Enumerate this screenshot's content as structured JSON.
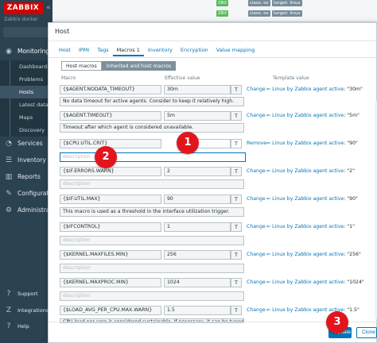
{
  "sidebar": {
    "logo": "ZABBIX",
    "subtitle": "Zabbix docker",
    "collapse_icon": "«",
    "items": [
      {
        "label": "Monitoring",
        "icon": "eye-icon",
        "glyph": "◉"
      },
      {
        "label": "Services",
        "icon": "services-icon",
        "glyph": "◔"
      },
      {
        "label": "Inventory",
        "icon": "inventory-icon",
        "glyph": "☰"
      },
      {
        "label": "Reports",
        "icon": "reports-icon",
        "glyph": "▥"
      },
      {
        "label": "Configurat",
        "icon": "config-icon",
        "glyph": "✎"
      },
      {
        "label": "Administra",
        "icon": "admin-icon",
        "glyph": "⚙"
      },
      {
        "label": "Support",
        "icon": "support-icon",
        "glyph": "?"
      },
      {
        "label": "Integrations",
        "icon": "integrations-icon",
        "glyph": "Z"
      },
      {
        "label": "Help",
        "icon": "help-icon",
        "glyph": "?"
      }
    ],
    "submenu": [
      "Dashboard",
      "Problems",
      "Hosts",
      "Latest data",
      "Maps",
      "Discovery"
    ]
  },
  "topstrip": {
    "tag_zbx_1": "ZBX",
    "tag_zbx_2": "ZBX",
    "tag_class_os": "class: os",
    "tag_target_linux": "target: linux"
  },
  "dialog": {
    "title": "Host",
    "tabs": [
      "Host",
      "IPMI",
      "Tags",
      "Macros 1",
      "Inventory",
      "Encryption",
      "Value mapping"
    ],
    "subtabs": [
      "Host macros",
      "Inherited and host macros"
    ],
    "col_macro": "Macro",
    "col_effective": "Effective value",
    "col_template": "Template value",
    "type_glyph": "T",
    "description_placeholder": "description",
    "rows": [
      {
        "macro": "{$AGENT.NODATA_TIMEOUT}",
        "value": "30m",
        "action": "Change",
        "template": "Linux by Zabbix agent active",
        "tvalue": "\"30m\"",
        "desc": "No data timeout for active agents. Consider to keep it relatively high."
      },
      {
        "macro": "{$AGENT.TIMEOUT}",
        "value": "5m",
        "action": "Change",
        "template": "Linux by Zabbix agent active",
        "tvalue": "\"5m\"",
        "desc": "Timeout after which agent is considered unavailable."
      },
      {
        "macro": "{$CPU.UTIL.CRIT}",
        "value": "95",
        "action": "Remove",
        "template": "Linux by Zabbix agent active",
        "tvalue": "\"90\"",
        "desc": ""
      },
      {
        "macro": "{$IF.ERRORS.WARN}",
        "value": "2",
        "action": "Change",
        "template": "Linux by Zabbix agent active",
        "tvalue": "\"2\"",
        "desc": ""
      },
      {
        "macro": "{$IF.UTIL.MAX}",
        "value": "90",
        "action": "Change",
        "template": "Linux by Zabbix agent active",
        "tvalue": "\"90\"",
        "desc": "This macro is used as a threshold in the interface utilization trigger."
      },
      {
        "macro": "{$IFCONTROL}",
        "value": "1",
        "action": "Change",
        "template": "Linux by Zabbix agent active",
        "tvalue": "\"1\"",
        "desc": ""
      },
      {
        "macro": "{$KERNEL.MAXFILES.MIN}",
        "value": "256",
        "action": "Change",
        "template": "Linux by Zabbix agent active",
        "tvalue": "\"256\"",
        "desc": ""
      },
      {
        "macro": "{$KERNEL.MAXPROC.MIN}",
        "value": "1024",
        "action": "Change",
        "template": "Linux by Zabbix agent active",
        "tvalue": "\"1024\"",
        "desc": ""
      },
      {
        "macro": "{$LOAD_AVG_PER_CPU.MAX.WARN}",
        "value": "1.5",
        "action": "Change",
        "template": "Linux by Zabbix agent active",
        "tvalue": "\"1.5\"",
        "desc": "CPU load per core is considered sustainable. If necessary, it can be tuned."
      }
    ],
    "update": "Update",
    "clone": "Clone"
  },
  "callouts": [
    "1",
    "2",
    "3"
  ],
  "colors": {
    "accent": "#0275b8",
    "callout": "#e3151c",
    "sidebar": "#2b4251",
    "logo": "#d40000"
  }
}
